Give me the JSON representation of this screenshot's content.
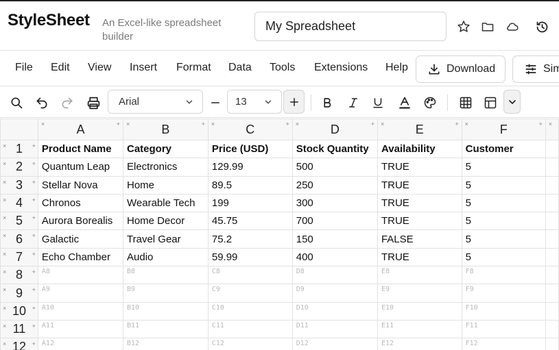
{
  "app": {
    "name": "StyleSheet",
    "tagline": "An Excel-like spreadsheet builder",
    "document_title": "My Spreadsheet"
  },
  "header_icons": [
    "star-icon",
    "folder-icon",
    "cloud-icon",
    "history-icon"
  ],
  "menu": {
    "items": [
      "File",
      "Edit",
      "View",
      "Insert",
      "Format",
      "Data",
      "Tools",
      "Extensions",
      "Help"
    ],
    "download_label": "Download",
    "simulate_label": "Sim"
  },
  "toolbar": {
    "font": "Arial",
    "font_size": "13"
  },
  "grid": {
    "columns": [
      "A",
      "B",
      "C",
      "D",
      "E",
      "F"
    ],
    "row_numbers": [
      "1",
      "2",
      "3",
      "4",
      "5",
      "6",
      "7",
      "8",
      "9",
      "10",
      "11",
      "12"
    ],
    "rows": [
      [
        "Product Name",
        "Category",
        "Price (USD)",
        "Stock Quantity",
        "Availability",
        "Customer"
      ],
      [
        "Quantum Leap",
        "Electronics",
        "129.99",
        "500",
        "TRUE",
        "5"
      ],
      [
        "Stellar Nova",
        "Home",
        "89.5",
        "250",
        "TRUE",
        "5"
      ],
      [
        "Chronos",
        "Wearable Tech",
        "199",
        "300",
        "TRUE",
        "5"
      ],
      [
        "Aurora Borealis",
        "Home Decor",
        "45.75",
        "700",
        "TRUE",
        "5"
      ],
      [
        "Galactic",
        "Travel Gear",
        "75.2",
        "150",
        "FALSE",
        "5"
      ],
      [
        "Echo Chamber",
        "Audio",
        "59.99",
        "400",
        "TRUE",
        "5"
      ]
    ],
    "placeholders": [
      [
        "A8",
        "B8",
        "C8",
        "D8",
        "E8",
        "F8"
      ],
      [
        "A9",
        "B9",
        "C9",
        "D9",
        "E9",
        "F9"
      ],
      [
        "A10",
        "B10",
        "C10",
        "D10",
        "E10",
        "F10"
      ],
      [
        "A11",
        "B11",
        "C11",
        "D11",
        "E11",
        "F11"
      ],
      [
        "A12",
        "B12",
        "C12",
        "D12",
        "E12",
        "F12"
      ]
    ]
  }
}
